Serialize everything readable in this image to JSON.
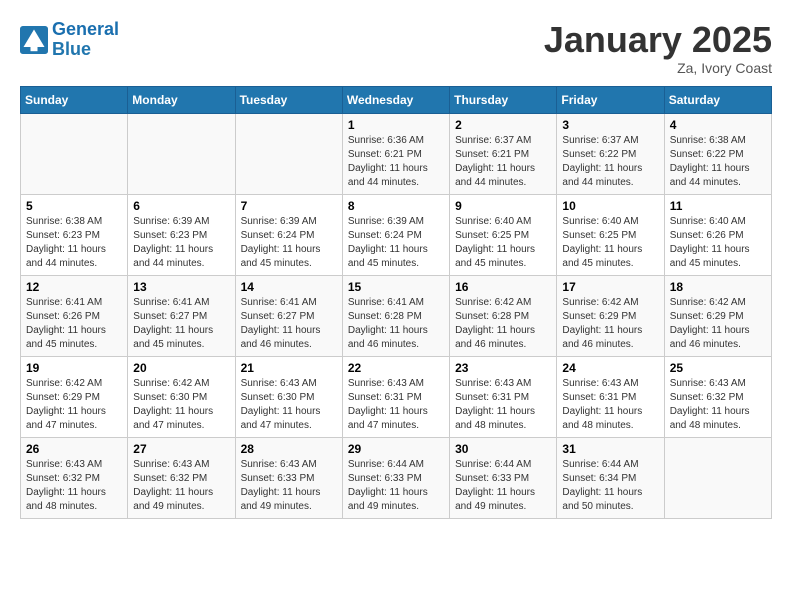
{
  "logo": {
    "line1": "General",
    "line2": "Blue"
  },
  "title": "January 2025",
  "subtitle": "Za, Ivory Coast",
  "days_header": [
    "Sunday",
    "Monday",
    "Tuesday",
    "Wednesday",
    "Thursday",
    "Friday",
    "Saturday"
  ],
  "weeks": [
    [
      {
        "num": "",
        "info": ""
      },
      {
        "num": "",
        "info": ""
      },
      {
        "num": "",
        "info": ""
      },
      {
        "num": "1",
        "info": "Sunrise: 6:36 AM\nSunset: 6:21 PM\nDaylight: 11 hours and 44 minutes."
      },
      {
        "num": "2",
        "info": "Sunrise: 6:37 AM\nSunset: 6:21 PM\nDaylight: 11 hours and 44 minutes."
      },
      {
        "num": "3",
        "info": "Sunrise: 6:37 AM\nSunset: 6:22 PM\nDaylight: 11 hours and 44 minutes."
      },
      {
        "num": "4",
        "info": "Sunrise: 6:38 AM\nSunset: 6:22 PM\nDaylight: 11 hours and 44 minutes."
      }
    ],
    [
      {
        "num": "5",
        "info": "Sunrise: 6:38 AM\nSunset: 6:23 PM\nDaylight: 11 hours and 44 minutes."
      },
      {
        "num": "6",
        "info": "Sunrise: 6:39 AM\nSunset: 6:23 PM\nDaylight: 11 hours and 44 minutes."
      },
      {
        "num": "7",
        "info": "Sunrise: 6:39 AM\nSunset: 6:24 PM\nDaylight: 11 hours and 45 minutes."
      },
      {
        "num": "8",
        "info": "Sunrise: 6:39 AM\nSunset: 6:24 PM\nDaylight: 11 hours and 45 minutes."
      },
      {
        "num": "9",
        "info": "Sunrise: 6:40 AM\nSunset: 6:25 PM\nDaylight: 11 hours and 45 minutes."
      },
      {
        "num": "10",
        "info": "Sunrise: 6:40 AM\nSunset: 6:25 PM\nDaylight: 11 hours and 45 minutes."
      },
      {
        "num": "11",
        "info": "Sunrise: 6:40 AM\nSunset: 6:26 PM\nDaylight: 11 hours and 45 minutes."
      }
    ],
    [
      {
        "num": "12",
        "info": "Sunrise: 6:41 AM\nSunset: 6:26 PM\nDaylight: 11 hours and 45 minutes."
      },
      {
        "num": "13",
        "info": "Sunrise: 6:41 AM\nSunset: 6:27 PM\nDaylight: 11 hours and 45 minutes."
      },
      {
        "num": "14",
        "info": "Sunrise: 6:41 AM\nSunset: 6:27 PM\nDaylight: 11 hours and 46 minutes."
      },
      {
        "num": "15",
        "info": "Sunrise: 6:41 AM\nSunset: 6:28 PM\nDaylight: 11 hours and 46 minutes."
      },
      {
        "num": "16",
        "info": "Sunrise: 6:42 AM\nSunset: 6:28 PM\nDaylight: 11 hours and 46 minutes."
      },
      {
        "num": "17",
        "info": "Sunrise: 6:42 AM\nSunset: 6:29 PM\nDaylight: 11 hours and 46 minutes."
      },
      {
        "num": "18",
        "info": "Sunrise: 6:42 AM\nSunset: 6:29 PM\nDaylight: 11 hours and 46 minutes."
      }
    ],
    [
      {
        "num": "19",
        "info": "Sunrise: 6:42 AM\nSunset: 6:29 PM\nDaylight: 11 hours and 47 minutes."
      },
      {
        "num": "20",
        "info": "Sunrise: 6:42 AM\nSunset: 6:30 PM\nDaylight: 11 hours and 47 minutes."
      },
      {
        "num": "21",
        "info": "Sunrise: 6:43 AM\nSunset: 6:30 PM\nDaylight: 11 hours and 47 minutes."
      },
      {
        "num": "22",
        "info": "Sunrise: 6:43 AM\nSunset: 6:31 PM\nDaylight: 11 hours and 47 minutes."
      },
      {
        "num": "23",
        "info": "Sunrise: 6:43 AM\nSunset: 6:31 PM\nDaylight: 11 hours and 48 minutes."
      },
      {
        "num": "24",
        "info": "Sunrise: 6:43 AM\nSunset: 6:31 PM\nDaylight: 11 hours and 48 minutes."
      },
      {
        "num": "25",
        "info": "Sunrise: 6:43 AM\nSunset: 6:32 PM\nDaylight: 11 hours and 48 minutes."
      }
    ],
    [
      {
        "num": "26",
        "info": "Sunrise: 6:43 AM\nSunset: 6:32 PM\nDaylight: 11 hours and 48 minutes."
      },
      {
        "num": "27",
        "info": "Sunrise: 6:43 AM\nSunset: 6:32 PM\nDaylight: 11 hours and 49 minutes."
      },
      {
        "num": "28",
        "info": "Sunrise: 6:43 AM\nSunset: 6:33 PM\nDaylight: 11 hours and 49 minutes."
      },
      {
        "num": "29",
        "info": "Sunrise: 6:44 AM\nSunset: 6:33 PM\nDaylight: 11 hours and 49 minutes."
      },
      {
        "num": "30",
        "info": "Sunrise: 6:44 AM\nSunset: 6:33 PM\nDaylight: 11 hours and 49 minutes."
      },
      {
        "num": "31",
        "info": "Sunrise: 6:44 AM\nSunset: 6:34 PM\nDaylight: 11 hours and 50 minutes."
      },
      {
        "num": "",
        "info": ""
      }
    ]
  ]
}
